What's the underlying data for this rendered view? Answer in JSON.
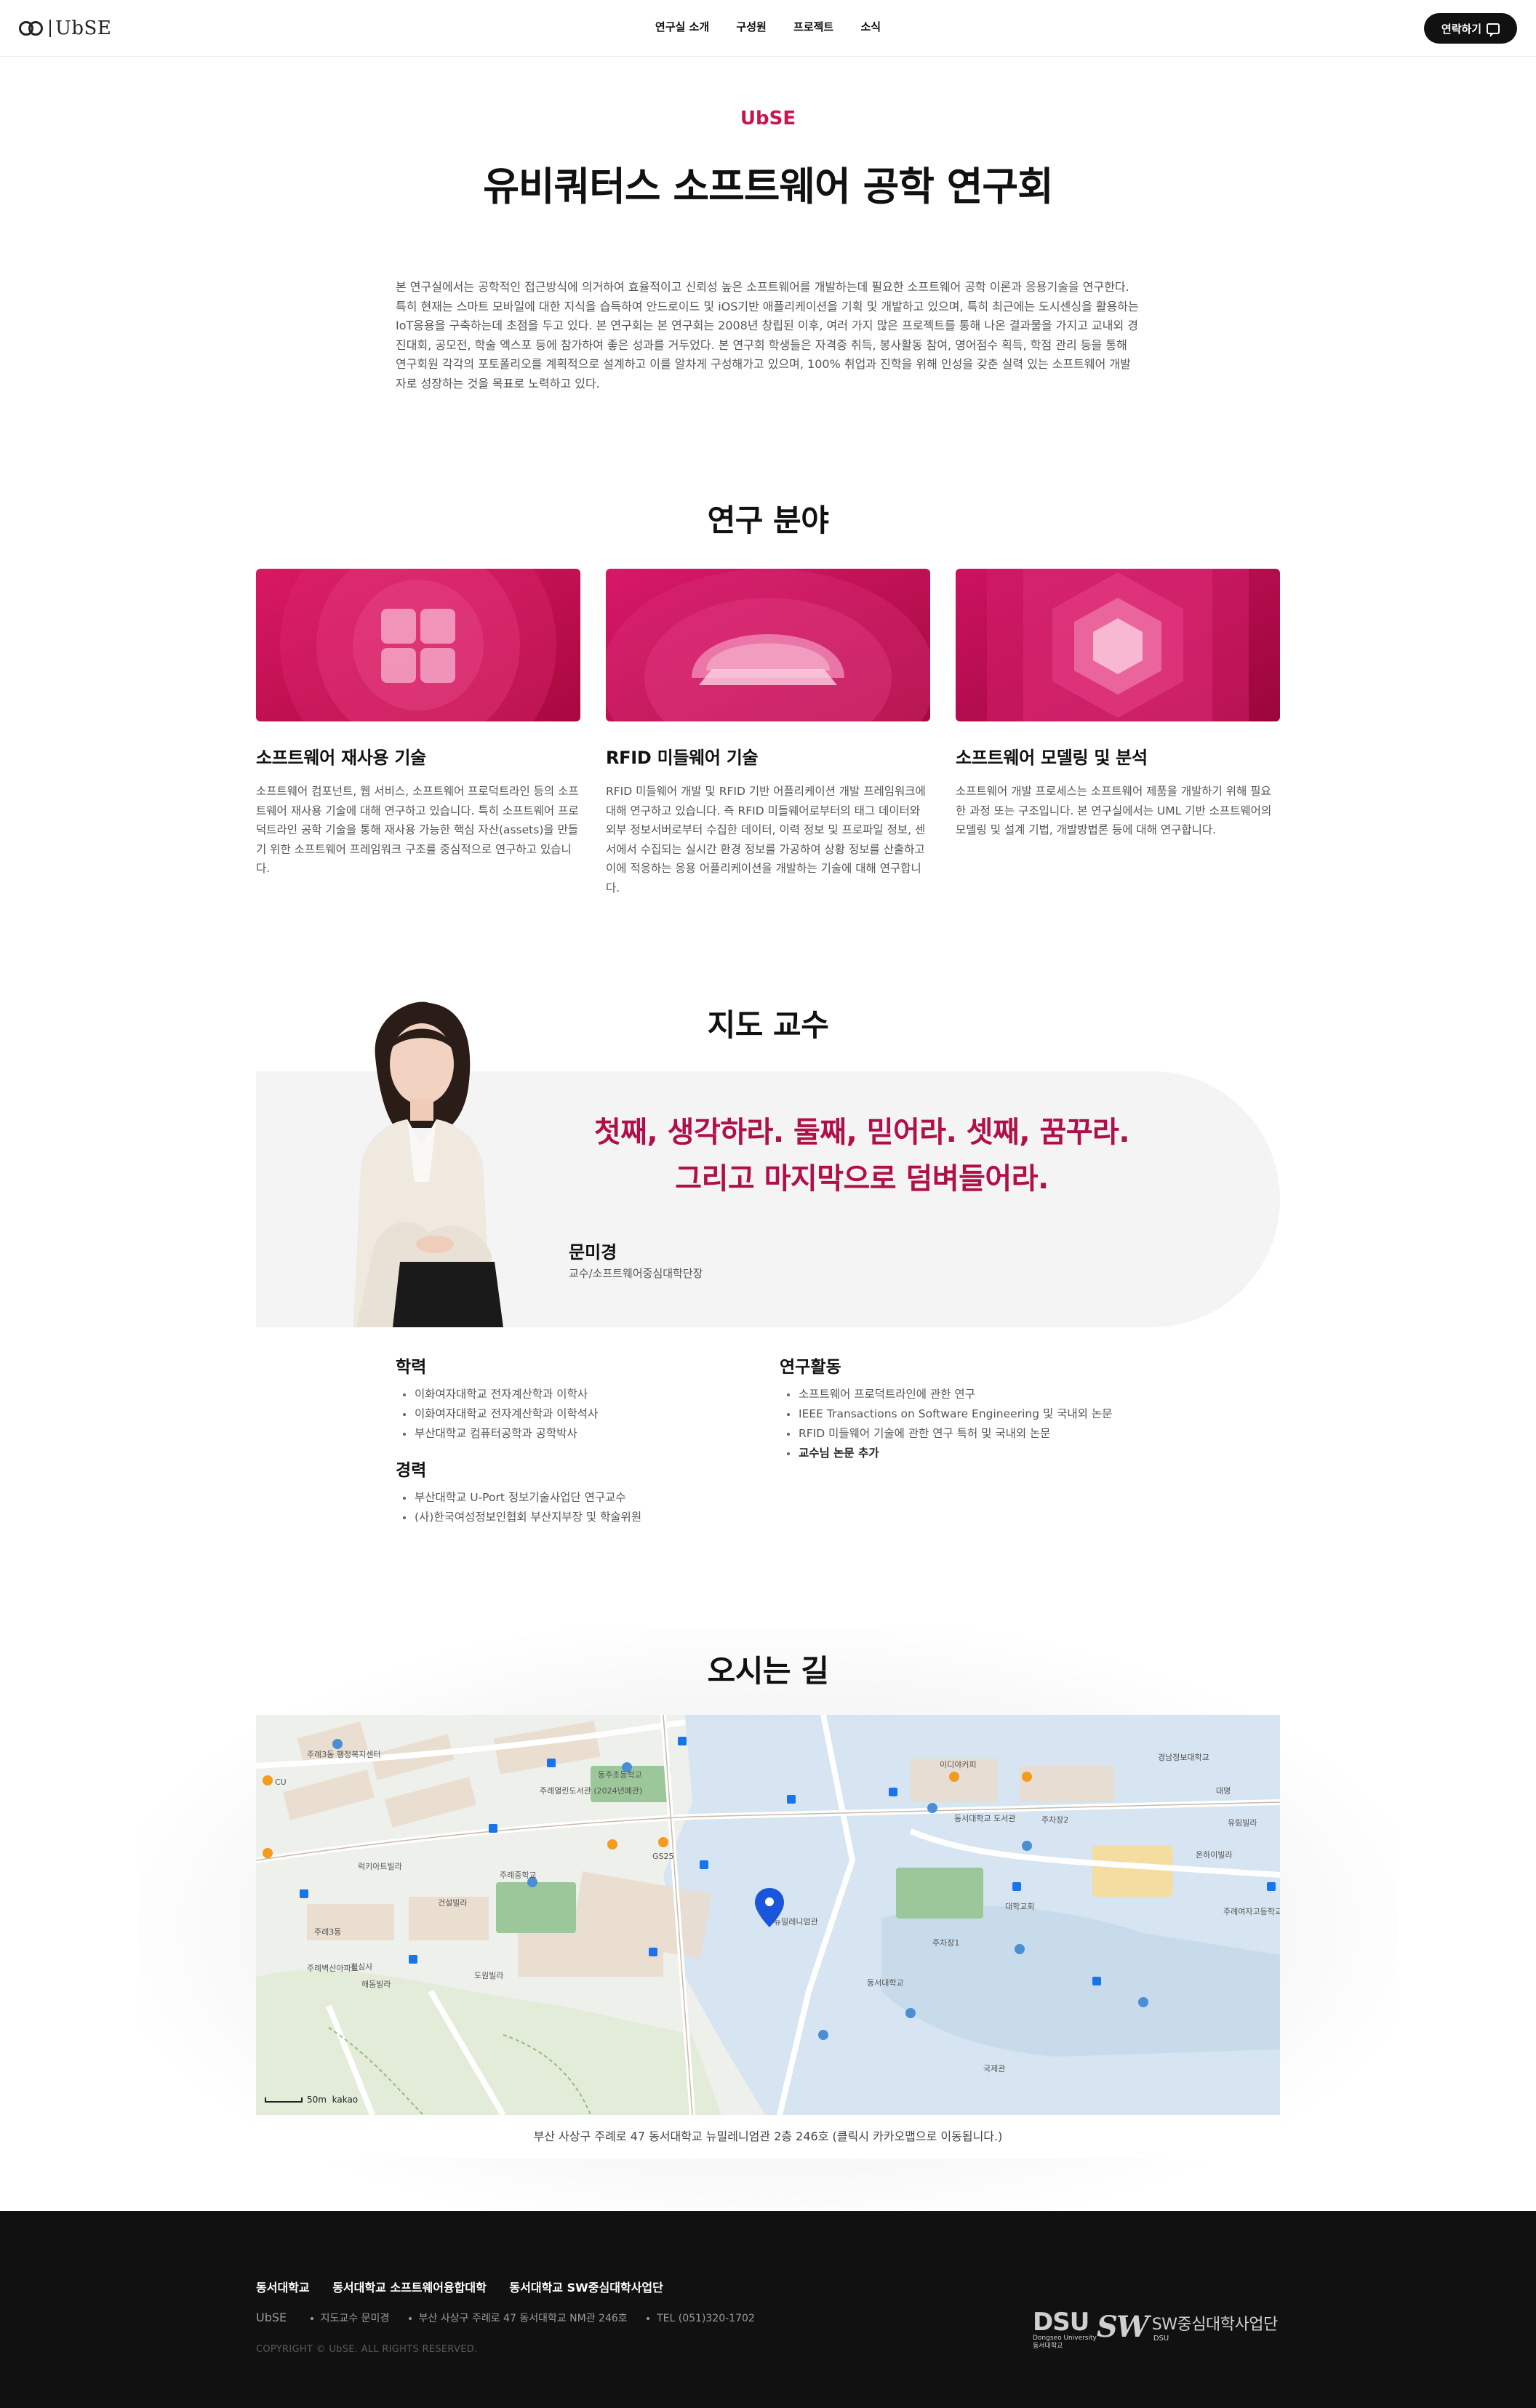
{
  "nav": {
    "logo_text": "UbSE",
    "menu": [
      "연구실 소개",
      "구성원",
      "프로젝트",
      "소식"
    ],
    "cta_label": "연락하기"
  },
  "hero": {
    "eyebrow": "UbSE",
    "title": "유비쿼터스 소프트웨어 공학 연구회",
    "intro": "본 연구실에서는 공학적인 접근방식에 의거하여 효율적이고 신뢰성 높은 소프트웨어를 개발하는데 필요한 소프트웨어 공학 이론과 응용기술을 연구한다. 특히 현재는 스마트 모바일에 대한 지식을 습득하여 안드로이드 및 iOS기반 애플리케이션을 기획 및 개발하고 있으며, 특히 최근에는 도시센싱을 활용하는 IoT응용을 구축하는데 초점을 두고 있다. 본 연구회는 본 연구회는 2008년 창립된 이후, 여러 가지 많은 프로젝트를 통해 나온 결과물을 가지고 교내외 경진대회, 공모전, 학술 엑스포 등에 참가하여 좋은 성과를 거두었다. 본 연구회 학생들은 자격증 취득, 봉사활동 참여, 영어점수 획득, 학점 관리 등을 통해 연구회원 각각의 포토폴리오를 계획적으로 설계하고 이를 알차게 구성해가고 있으며, 100% 취업과 진학을 위해 인성을 갖춘 실력 있는 소프트웨어 개발자로 성장하는 것을 목표로 노력하고 있다."
  },
  "research": {
    "title": "연구 분야",
    "cards": [
      {
        "title": "소프트웨어 재사용 기술",
        "desc": "소프트웨어 컴포넌트, 웹 서비스, 소프트웨어 프로덕트라인 등의 소프트웨어 재사용 기술에 대해 연구하고 있습니다. 특히 소프트웨어 프로덕트라인 공학 기술을 통해 재사용 가능한 핵심 자산(assets)을 만들기 위한 소프트웨어 프레임워크 구조를 중심적으로 연구하고 있습니다."
      },
      {
        "title": "RFID 미들웨어 기술",
        "desc": "RFID 미들웨어 개발 및 RFID 기반 어플리케이션 개발 프레임워크에 대해 연구하고 있습니다. 즉 RFID 미들웨어로부터의 태그 데이터와 외부 정보서버로부터 수집한 데이터, 이력 정보 및 프로파일 정보, 센서에서 수집되는 실시간 환경 정보를 가공하여 상황 정보를 산출하고 이에 적응하는 응용 어플리케이션을 개발하는 기술에 대해 연구합니다."
      },
      {
        "title": "소프트웨어 모델링 및 분석",
        "desc": "소프트웨어 개발 프로세스는 소프트웨어 제품을 개발하기 위해 필요한 과정 또는 구조입니다. 본 연구실에서는 UML 기반 소프트웨어의 모델링 및 설계 기법, 개발방법론 등에 대해 연구합니다."
      }
    ]
  },
  "professor": {
    "section_title": "지도 교수",
    "quote_line1": "첫째, 생각하라. 둘째, 믿어라. 셋째, 꿈꾸라.",
    "quote_line2": "그리고 마지막으로 덤벼들어라.",
    "name": "문미경",
    "role": "교수/소프트웨어중심대학단장",
    "education": {
      "title": "학력",
      "items": [
        "이화여자대학교 전자계산학과 이학사",
        "이화여자대학교 전자계산학과 이학석사",
        "부산대학교 컴퓨터공학과 공학박사"
      ]
    },
    "career": {
      "title": "경력",
      "items": [
        "부산대학교 U-Port 정보기술사업단 연구교수",
        "(사)한국여성정보인협회 부산지부장 및 학술위원"
      ]
    },
    "activities": {
      "title": "연구활동",
      "items": [
        "소프트웨어 프로덕트라인에 관한 연구",
        "IEEE Transactions on Software Engineering 및 국내외 논문",
        "RFID 미들웨어 기술에 관한 연구 특허 및 국내외 논문"
      ],
      "extra": "교수님 논문 추가"
    }
  },
  "location": {
    "title": "오시는 길",
    "caption": "부산 사상구 주례로 47 동서대학교 뉴밀레니엄관 2층 246호 (클릭시 카카오맵으로 이동됩니다.)",
    "scale": "50m",
    "provider": "kakao",
    "labels": [
      "주례3동 행정복지센터",
      "동서대학교",
      "경남정보대학교",
      "주례여자고등학교",
      "주례열린도서관 (2024년폐관)",
      "동주초등학교",
      "주례중학교",
      "GS25",
      "CU",
      "이디야커피",
      "뉴밀레니엄관",
      "대학교회",
      "동서대학교 도서관",
      "주차장2",
      "주차장1",
      "국제관",
      "건설빌라",
      "도원빌라",
      "주례3동",
      "주례벽산아파트",
      "청심사",
      "해동빌라",
      "럭키아트빌라",
      "대명",
      "유림빌라",
      "온하이빌라"
    ]
  },
  "footer": {
    "links": [
      "동서대학교",
      "동서대학교 소프트웨어융합대학",
      "동서대학교 SW중심대학사업단"
    ],
    "brand": "UbSE",
    "info": [
      "지도교수 문미경",
      "부산 사상구 주례로 47 동서대학교 NM관 246호",
      "TEL (051)320-1702"
    ],
    "copyright": "COPYRIGHT © UbSE. ALL RIGHTS RESERVED.",
    "logo_dsu": "DSU",
    "logo_dsu_sub1": "Dongseo University",
    "logo_dsu_sub2": "동서대학교",
    "logo_sw_mark": "SW",
    "logo_sw_text": "SW중심대학사업단",
    "logo_sw_sub": "DSU"
  },
  "colors": {
    "accent": "#c8144f",
    "quote": "#b01047",
    "footer_bg": "#111111"
  }
}
